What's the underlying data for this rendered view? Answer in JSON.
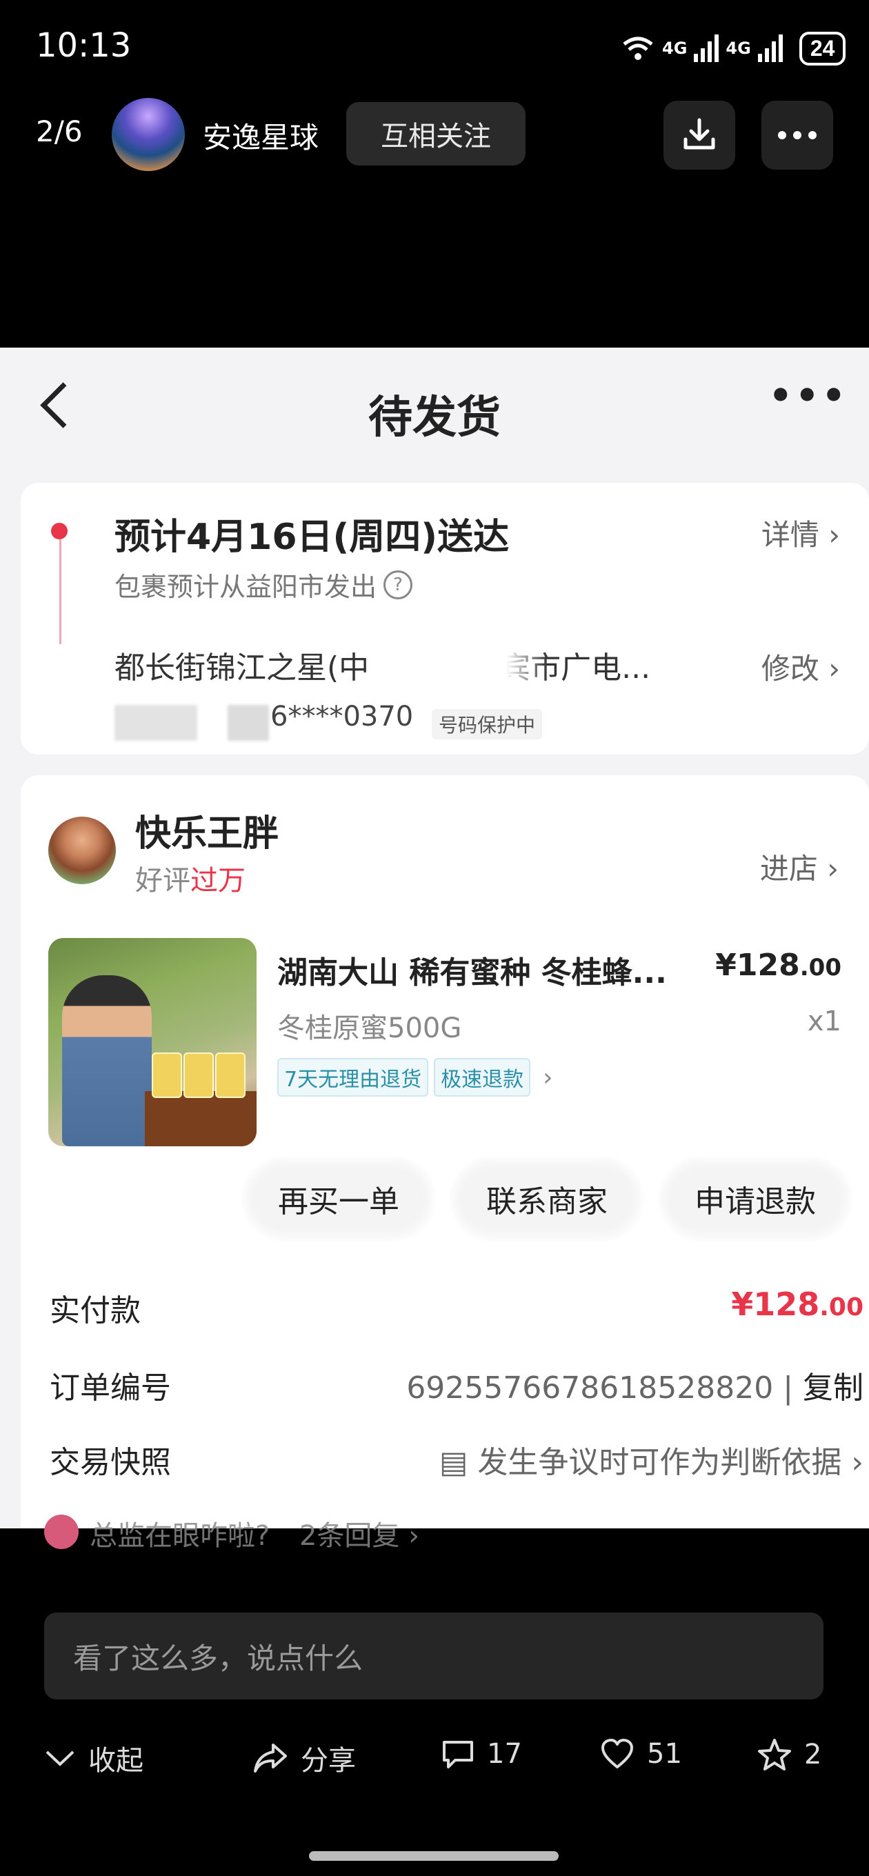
{
  "status_bar": {
    "time": "10:13",
    "net1": "4G",
    "net2": "4G",
    "battery": "24"
  },
  "viewer": {
    "page_indicator": "2/6",
    "author_name": "安逸星球",
    "follow_label": "互相关注"
  },
  "order": {
    "title": "待发货",
    "eta": "预计4月16日(周四)送达",
    "eta_sub": "包裹预计从益阳市发出",
    "detail_link": "详情 ›",
    "address": "都长街锦江之星(中",
    "address_tail": "宾市广电...",
    "modify_link": "修改 ›",
    "phone": "6****0370",
    "phone_tag": "号码保护中",
    "shop": {
      "name": "快乐王胖",
      "rating_prefix": "好评",
      "rating_value": "过万",
      "enter_label": "进店 ›"
    },
    "product": {
      "title": "湖南大山 稀有蜜种 冬桂蜂...",
      "price_main": "¥128",
      "price_cents": ".00",
      "spec": "冬桂原蜜500G",
      "qty": "x1",
      "tags": [
        "7天无理由退货",
        "极速退款"
      ]
    },
    "buttons": [
      "再买一单",
      "联系商家",
      "申请退款"
    ],
    "paid_label": "实付款",
    "paid_main": "¥128",
    "paid_cents": ".00",
    "order_no_label": "订单编号",
    "order_no": "6925576678618528820",
    "copy_label": "复制",
    "snapshot_label": "交易快照",
    "snapshot_value": "发生争议时可作为判断依据 ›"
  },
  "comment_preview": {
    "text": "总监在眼咋啦?",
    "replies": "2条回复 ›"
  },
  "input_placeholder": "看了这么多，说点什么",
  "actions": {
    "collapse": "收起",
    "share": "分享",
    "comments": "17",
    "likes": "51",
    "stars": "2"
  }
}
